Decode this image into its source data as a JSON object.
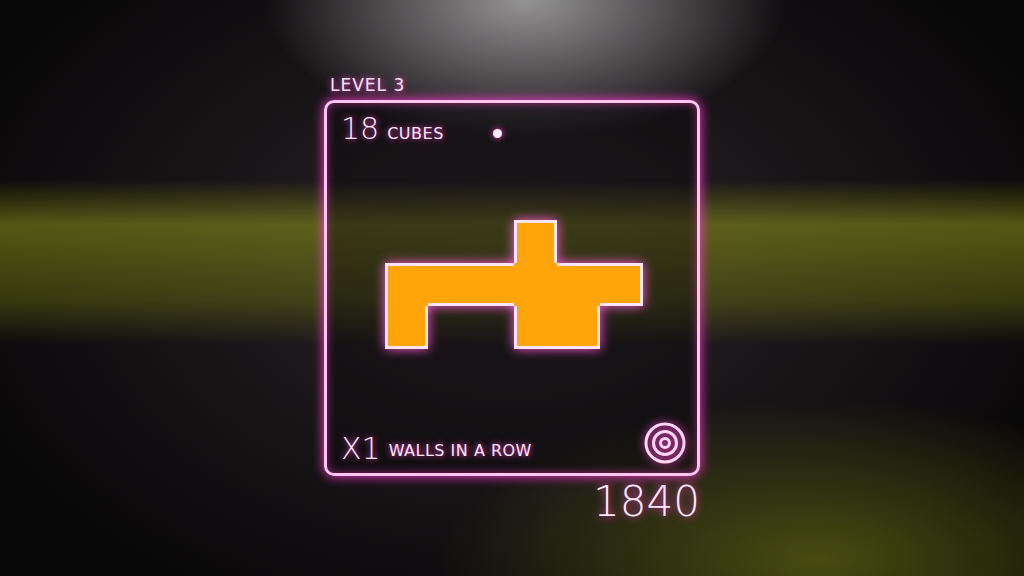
{
  "level": {
    "label": "LEVEL 3"
  },
  "cubes": {
    "count": "18",
    "label": "CUBES"
  },
  "wall": {
    "cells": [
      [
        false,
        false,
        false,
        true,
        false,
        false
      ],
      [
        true,
        true,
        true,
        true,
        true,
        true
      ],
      [
        true,
        false,
        false,
        true,
        true,
        false
      ]
    ]
  },
  "streak": {
    "multiplier": "X1",
    "label": "WALLS IN A ROW"
  },
  "score": "1840"
}
